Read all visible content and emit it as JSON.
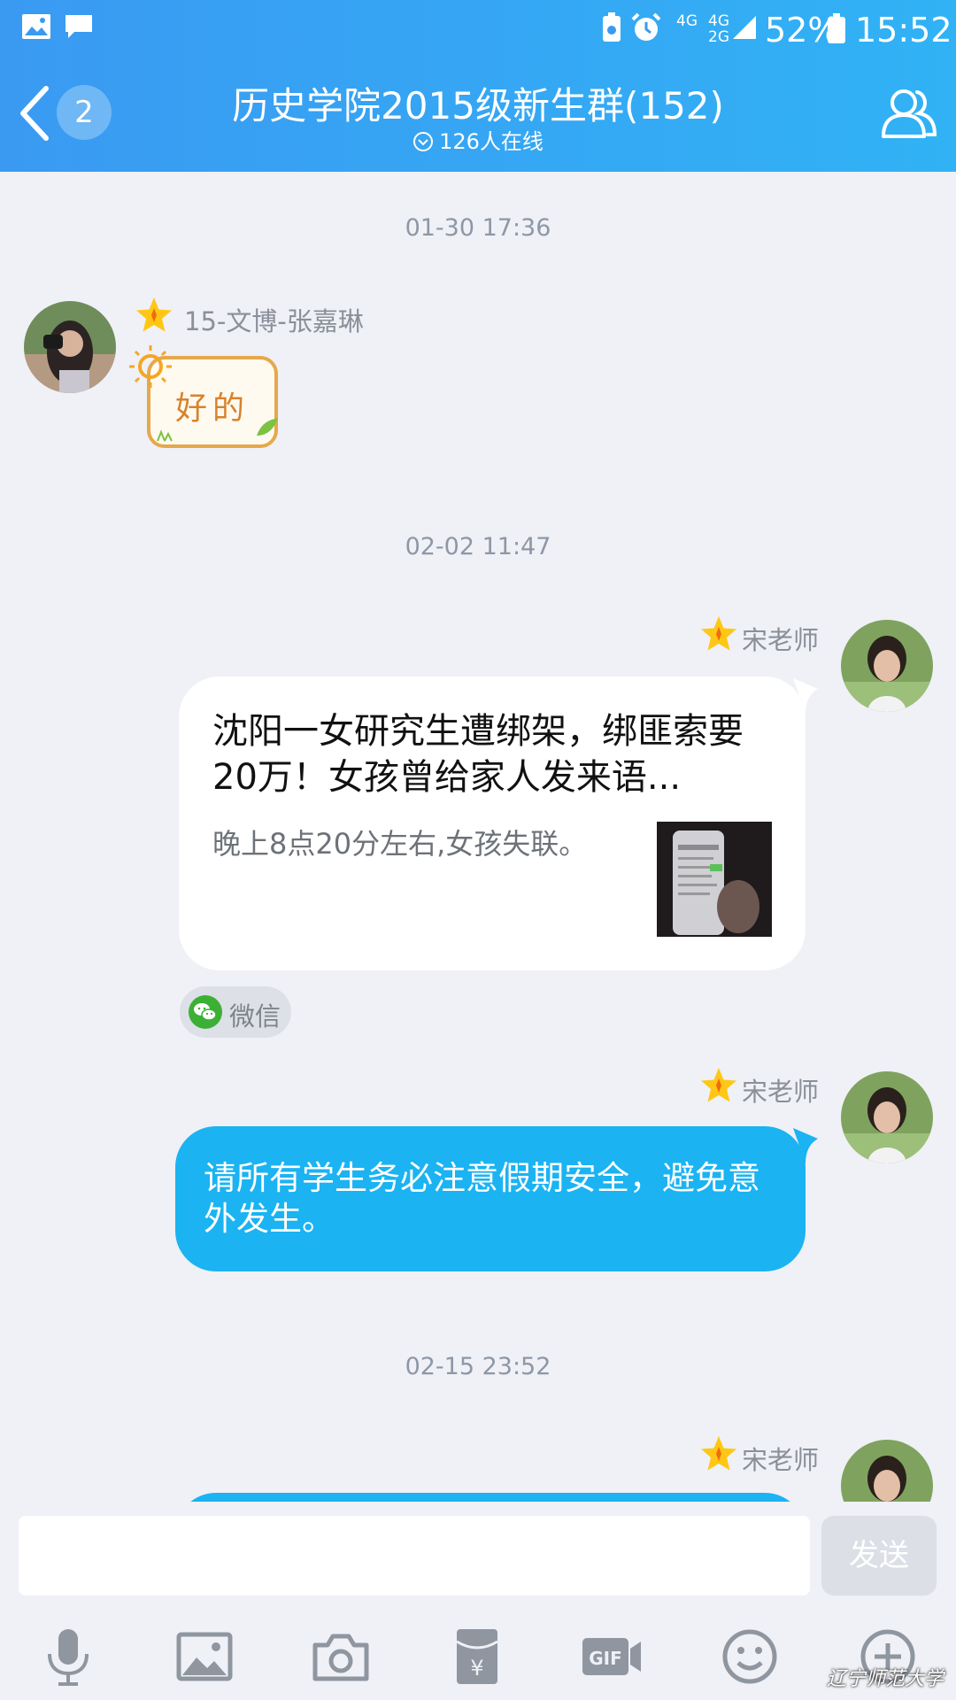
{
  "status_bar": {
    "network_4g": "4G",
    "network_4g2g_top": "4G",
    "network_4g2g_bottom": "2G",
    "battery": "52%",
    "time": "15:52"
  },
  "header": {
    "badge_count": "2",
    "title": "历史学院2015级新生群(152)",
    "online": "126人在线"
  },
  "messages": {
    "ts1": "01-30 17:36",
    "m1_name": "15-文博-张嘉琳",
    "m1_sticker_text": "好的",
    "ts2": "02-02 11:47",
    "m2_name": "宋老师",
    "m2_card_title": "沈阳一女研究生遭绑架，绑匪索要20万！女孩曾给家人发来语...",
    "m2_card_summary": "晚上8点20分左右,女孩失联。",
    "m2_source": "微信",
    "m3_name": "宋老师",
    "m3_text": "请所有学生务必注意假期安全，避免意外发生。",
    "ts3": "02-15 23:52",
    "m4_name": "宋老师"
  },
  "input": {
    "send_label": "发送"
  },
  "watermark": "辽宁师范大学",
  "colors": {
    "header_start": "#3a9af2",
    "header_end": "#31b2f5",
    "blue_bubble": "#1bb3f2",
    "background": "#eff1f6"
  },
  "icons": [
    "gallery-icon",
    "message-icon",
    "battery-saver-icon",
    "alarm-icon",
    "signal-icon",
    "battery-icon",
    "back-icon",
    "profile-icon",
    "star-icon",
    "wechat-icon",
    "mic-icon",
    "image-icon",
    "camera-icon",
    "red-packet-icon",
    "gif-icon",
    "emoji-icon",
    "plus-icon"
  ]
}
